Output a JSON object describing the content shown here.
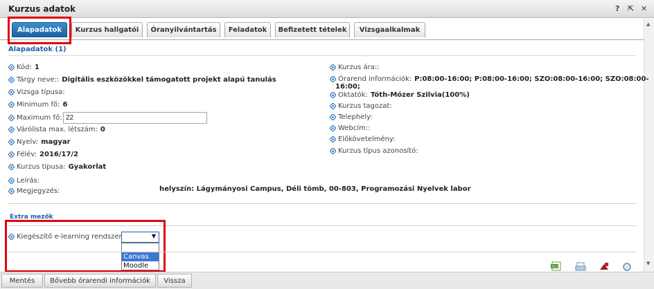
{
  "window": {
    "title": "Kurzus adatok",
    "help": "?",
    "popout": "⇱",
    "close": "✕"
  },
  "tabs": [
    {
      "label": "Alapadatok"
    },
    {
      "label": "Kurzus hallgatói"
    },
    {
      "label": "Óranyilvántartás"
    },
    {
      "label": "Feladatok"
    },
    {
      "label": "Befizetett tételek"
    },
    {
      "label": "Vizsgaalkalmak"
    }
  ],
  "section": {
    "title": "Alapadatok (1)"
  },
  "left": [
    {
      "label": "Kód:",
      "value": "1"
    },
    {
      "label": "Tárgy neve::",
      "value": "Digitális eszközökkel támogatott projekt alapú tanulás"
    },
    {
      "label": "Vizsga típusa:",
      "value": ""
    },
    {
      "label": "Minimum fő:",
      "value": "6"
    },
    {
      "label": "Maximum fő:",
      "value": ""
    },
    {
      "label": "Várólista max. létszám:",
      "value": "0"
    },
    {
      "label": "Nyelv:",
      "value": "magyar"
    },
    {
      "label": "Félév:",
      "value": "2016/17/2"
    },
    {
      "label": "Kurzus típusa:",
      "value": "Gyakorlat"
    },
    {
      "label": "Leírás:",
      "value": ""
    },
    {
      "label": "Megjegyzés:",
      "value": ""
    }
  ],
  "max_input": {
    "value": "22"
  },
  "note_value": "helyszín: Lágymányosi Campus, Déli tömb, 00-803, Programozási Nyelvek labor",
  "right": [
    {
      "label": "Kurzus ára::",
      "value": ""
    },
    {
      "label": "Órarend információk:",
      "value": "P:08:00-16:00; P:08:00-16:00; SZO:08:00-16:00; SZO:08:00-"
    },
    {
      "label": "",
      "value": "16:00;"
    },
    {
      "label": "Oktatók:",
      "value": "Tóth-Mózer Szilvia(100%)"
    },
    {
      "label": "Kurzus tagozat:",
      "value": ""
    },
    {
      "label": "Telephely:",
      "value": ""
    },
    {
      "label": "Webcím::",
      "value": ""
    },
    {
      "label": "Előkövetelmény:",
      "value": ""
    },
    {
      "label": "Kurzus típus azonosító:",
      "value": ""
    }
  ],
  "extra": {
    "title": "Extra mezők",
    "elearning_label": "Kiegészítő e-learning rendszer:",
    "select_value": "",
    "options": [
      "",
      "Canvas",
      "Moodle"
    ],
    "selected_option": "Canvas"
  },
  "toolbar_icons": [
    "xls-icon",
    "print-icon",
    "export-icon",
    "search-icon"
  ],
  "buttons": {
    "save": "Mentés",
    "more_schedule": "Bővebb órarendi információk",
    "back": "Vissza"
  },
  "colors": {
    "accent": "#1f5ea8",
    "tab_active": "#2a74b8",
    "highlight": "#e0000f"
  }
}
